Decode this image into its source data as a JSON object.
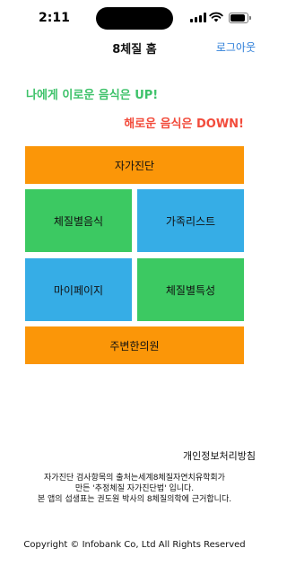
{
  "status_bar": {
    "time": "2:11"
  },
  "nav": {
    "title": "8체질 홈",
    "logout_label": "로그아웃"
  },
  "banner": {
    "up_text": "나에게 이로운 음식은 UP!",
    "down_text": "해로운 음식은 DOWN!"
  },
  "menu": {
    "self_diagnosis": "자가진단",
    "constitution_food": "체질별음식",
    "family_list": "가족리스트",
    "my_page": "마이페이지",
    "constitution_features": "체질별특성",
    "nearby_clinic": "주변한의원"
  },
  "footer": {
    "privacy_label": "개인정보처리방침",
    "note_lines": [
      "자가진단 검사항목의 출처는세계8체질자연치유학회가",
      "만든 '추정체질 자가진단법' 입니다.",
      "본 앱의 섭생표는 권도원 박사의 8체질의학에 근거합니다."
    ],
    "copyright": "Copyright © Infobank Co, Ltd All Rights Reserved"
  },
  "colors": {
    "orange": "#fb9608",
    "green": "#3cc962",
    "blue": "#36ade6",
    "up_green": "#3ec26a",
    "down_red": "#f24b3b",
    "link_blue": "#2f7fd9"
  }
}
